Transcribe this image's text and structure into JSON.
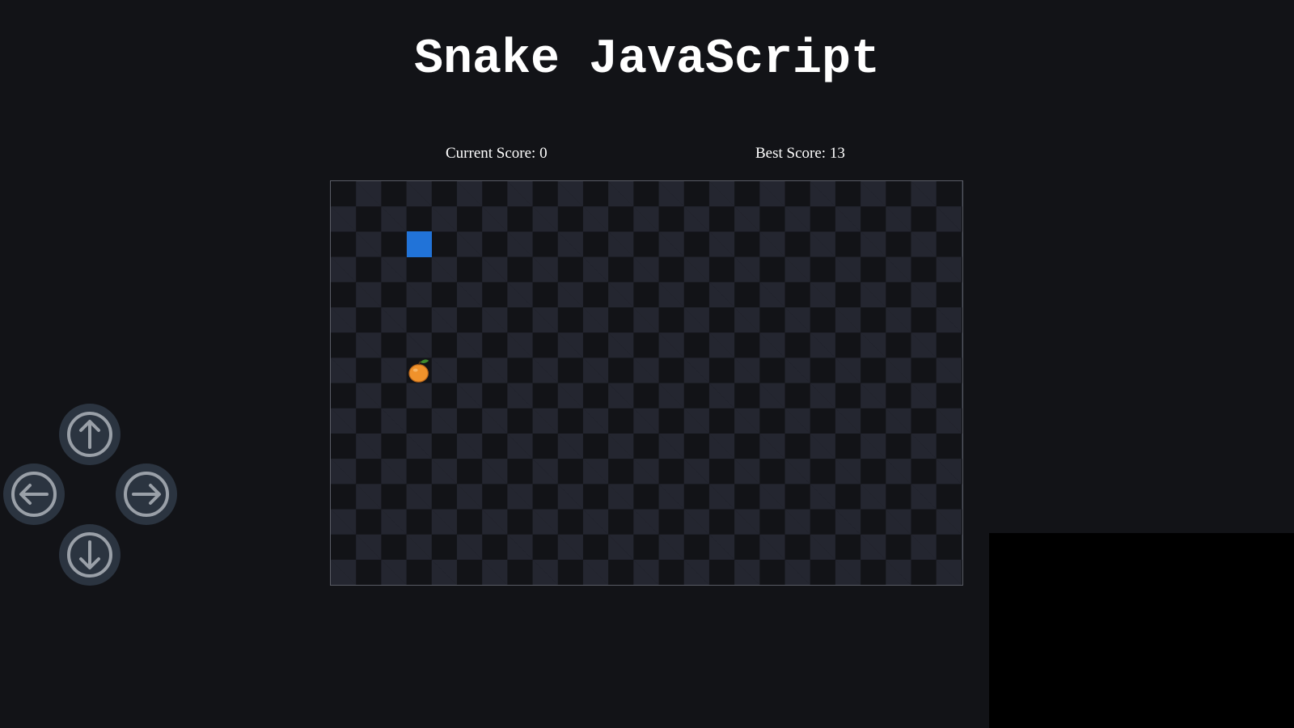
{
  "title": "Snake JavaScript",
  "scores": {
    "current_label": "Current Score: 0",
    "best_label": "Best Score: 13"
  },
  "board": {
    "columns": 25,
    "rows": 16,
    "snake": [
      {
        "col": 3,
        "row": 2
      }
    ],
    "food": {
      "col": 3,
      "row": 7,
      "icon": "orange-icon"
    },
    "colors": {
      "snake": "#2173d8",
      "tile_dark": "#121317",
      "tile_light": "#242630",
      "food": "#f0922b",
      "leaf": "#3f8a2e"
    }
  },
  "controls": [
    {
      "name": "up-button",
      "icon": "arrow-up-icon"
    },
    {
      "name": "left-button",
      "icon": "arrow-left-icon"
    },
    {
      "name": "right-button",
      "icon": "arrow-right-icon"
    },
    {
      "name": "down-button",
      "icon": "arrow-down-icon"
    }
  ]
}
